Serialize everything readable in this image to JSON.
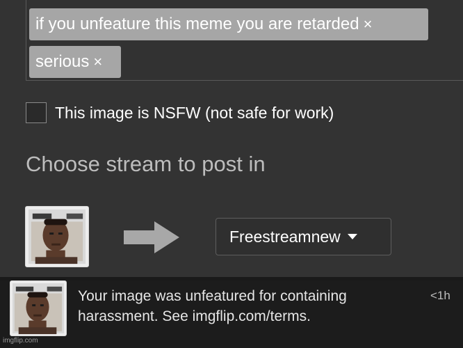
{
  "tags": [
    {
      "label": "if you unfeature this meme you are retarded",
      "remove": "×"
    },
    {
      "label": "serious",
      "remove": "×"
    }
  ],
  "nsfw": {
    "label": "This image is NSFW (not safe for work)",
    "checked": false
  },
  "stream": {
    "heading": "Choose stream to post in",
    "selected": "Freestreamnew"
  },
  "notification": {
    "message": "Your image was unfeatured for containing harassment. See imgflip.com/terms.",
    "time": "<1h"
  },
  "watermark": "imgflip.com",
  "colors": {
    "panel_bg": "#333333",
    "tag_bg": "#a6a6a6",
    "notification_bg": "#1c1c1c",
    "arrow": "#a8a8a8"
  },
  "icons": {
    "arrow": "right-arrow-icon",
    "caret": "caret-down-icon",
    "tag_remove": "close-icon"
  }
}
